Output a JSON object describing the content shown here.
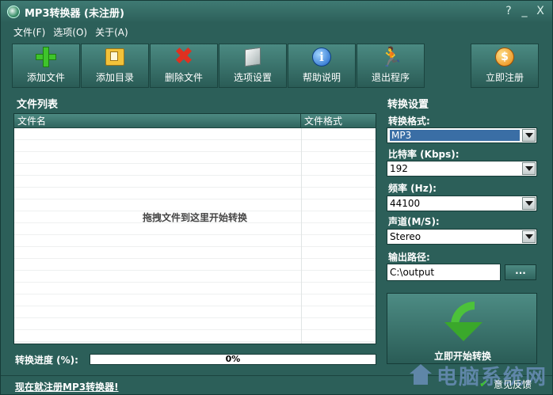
{
  "window": {
    "title": "MP3转换器 (未注册)",
    "controls": [
      "?",
      "_",
      "X"
    ]
  },
  "menu": [
    "文件(F)",
    "选项(O)",
    "关于(A)"
  ],
  "toolbar": {
    "add_file": {
      "label": "添加文件",
      "icon": "add-plus-icon"
    },
    "add_folder": {
      "label": "添加目录",
      "icon": "folder-icon"
    },
    "delete_file": {
      "label": "删除文件",
      "icon": "delete-x-icon"
    },
    "options": {
      "label": "选项设置",
      "icon": "cube-settings-icon"
    },
    "help": {
      "label": "帮助说明",
      "icon": "info-icon",
      "glyph": "i"
    },
    "exit": {
      "label": "退出程序",
      "icon": "runner-exit-icon",
      "glyph": "🏃"
    },
    "register": {
      "label": "立即注册",
      "icon": "coin-icon",
      "glyph": "$"
    }
  },
  "file_list": {
    "title": "文件列表",
    "columns": [
      "文件名",
      "文件格式"
    ],
    "rows": [],
    "empty_hint": "拖拽文件到这里开始转换"
  },
  "progress": {
    "label": "转换进度 (%):",
    "value": 0,
    "text": "0%"
  },
  "settings": {
    "title": "转换设置",
    "format": {
      "label": "转换格式:",
      "value": "MP3"
    },
    "bitrate": {
      "label": "比特率 (Kbps):",
      "value": "192"
    },
    "frequency": {
      "label": "频率 (Hz):",
      "value": "44100"
    },
    "channel": {
      "label": "声道(M/S):",
      "value": "Stereo"
    },
    "output": {
      "label": "输出路径:",
      "value": "C:\\output",
      "browse": "..."
    }
  },
  "convert_button": {
    "label": "立即开始转换"
  },
  "status": {
    "register_link": "现在就注册MP3转换器!",
    "feedback": "意见反馈",
    "watermark": "电脑系统网"
  },
  "colors": {
    "window_bg": "#2c5f59",
    "accent_green": "#3ec42b",
    "selection": "#3a6ea5"
  }
}
